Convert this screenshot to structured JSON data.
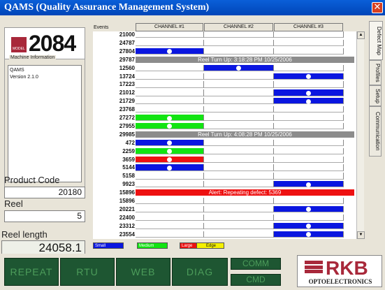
{
  "window": {
    "title": "QAMS (Quality Assurance Management System)"
  },
  "logo": {
    "model_text": "MODEL",
    "model_number": "2084"
  },
  "machine_info": {
    "legend": "Machine Information",
    "lines": [
      "QAMS",
      "Version 2.1.0"
    ]
  },
  "product": {
    "label": "Product Code",
    "value": "20180"
  },
  "reel": {
    "label": "Reel",
    "value": "5"
  },
  "reel_length": {
    "label": "Reel length",
    "value": "24058.1"
  },
  "grid": {
    "events_header": "Events",
    "channels": [
      "CHANNEL #1",
      "CHANNEL #2",
      "CHANNEL #3"
    ],
    "rows": [
      {
        "ev": "21000",
        "ch": [
          0,
          0,
          0
        ]
      },
      {
        "ev": "24787",
        "ch": [
          0,
          0,
          0
        ]
      },
      {
        "ev": "27804",
        "ch": [
          "blue",
          0,
          0
        ]
      },
      {
        "ev": "29787",
        "banner": "Reel Turn Up: 3:18:28 PM 10/25/2006",
        "color": "#8c8c8c"
      },
      {
        "ev": "12560",
        "ch": [
          0,
          "blue",
          0
        ]
      },
      {
        "ev": "13724",
        "ch": [
          0,
          0,
          "blue"
        ]
      },
      {
        "ev": "17223",
        "ch": [
          0,
          0,
          0
        ]
      },
      {
        "ev": "21012",
        "ch": [
          0,
          0,
          "blue"
        ]
      },
      {
        "ev": "21729",
        "ch": [
          0,
          0,
          "blue"
        ]
      },
      {
        "ev": "23768",
        "ch": [
          0,
          0,
          0
        ]
      },
      {
        "ev": "27272",
        "ch": [
          "green",
          0,
          0
        ]
      },
      {
        "ev": "27955",
        "ch": [
          "green",
          0,
          0
        ]
      },
      {
        "ev": "29985",
        "banner": "Reel Turn Up: 4:08:28 PM 10/25/2006",
        "color": "#8c8c8c"
      },
      {
        "ev": "472",
        "ch": [
          "blue",
          0,
          0
        ]
      },
      {
        "ev": "2259",
        "ch": [
          "green",
          0,
          0
        ]
      },
      {
        "ev": "3659",
        "ch": [
          "red",
          0,
          0
        ]
      },
      {
        "ev": "5144",
        "ch": [
          "blue",
          0,
          0
        ]
      },
      {
        "ev": "5158",
        "ch": [
          0,
          0,
          0
        ]
      },
      {
        "ev": "9923",
        "ch": [
          0,
          0,
          "blue"
        ]
      },
      {
        "ev": "15896",
        "banner": "Alert: Repeating defect: 5369",
        "color": "#ee1111"
      },
      {
        "ev": "15896",
        "ch": [
          0,
          0,
          0
        ]
      },
      {
        "ev": "20221",
        "ch": [
          0,
          0,
          "blue"
        ]
      },
      {
        "ev": "22400",
        "ch": [
          0,
          0,
          0
        ]
      },
      {
        "ev": "23312",
        "ch": [
          0,
          0,
          "blue"
        ]
      },
      {
        "ev": "23554",
        "ch": [
          0,
          0,
          "blue"
        ]
      }
    ]
  },
  "legend": {
    "small": "Small",
    "medium": "Medium",
    "large": "Large",
    "edge": "Edge"
  },
  "colors": {
    "blue": "#0a16e0",
    "green": "#12e412",
    "red": "#ee1111",
    "edge": "#f4f000"
  },
  "tabs": [
    "Defect Map",
    "Profiles",
    "Setup",
    "Communication"
  ],
  "buttons": {
    "repeat": "REPEAT",
    "rtu": "RTU",
    "web": "WEB",
    "diag": "DIAG",
    "comm": "COMM",
    "cmd": "CMD"
  },
  "brand": {
    "name": "RKB",
    "sub": "OPTOELECTRONICS"
  }
}
